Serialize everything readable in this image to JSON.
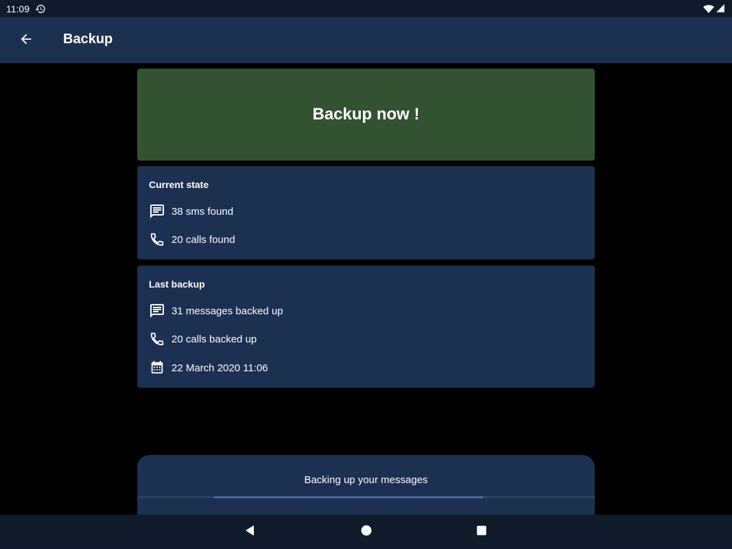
{
  "status_bar": {
    "time": "11:09"
  },
  "app_bar": {
    "title": "Backup"
  },
  "backup_button": {
    "label": "Backup now !"
  },
  "current_state": {
    "title": "Current state",
    "sms": "38 sms found",
    "calls": "20 calls found"
  },
  "last_backup": {
    "title": "Last backup",
    "messages": "31 messages backed up",
    "calls": "20 calls backed up",
    "date": "22 March 2020 11:06"
  },
  "progress": {
    "text": "Backing up your messages"
  },
  "colors": {
    "background": "#000000",
    "surface": "#1c3152",
    "backup_button": "#325232",
    "system_bars": "#0f1a2b",
    "progress_track": "#2b4464",
    "progress_fill": "#4a6d9c"
  }
}
